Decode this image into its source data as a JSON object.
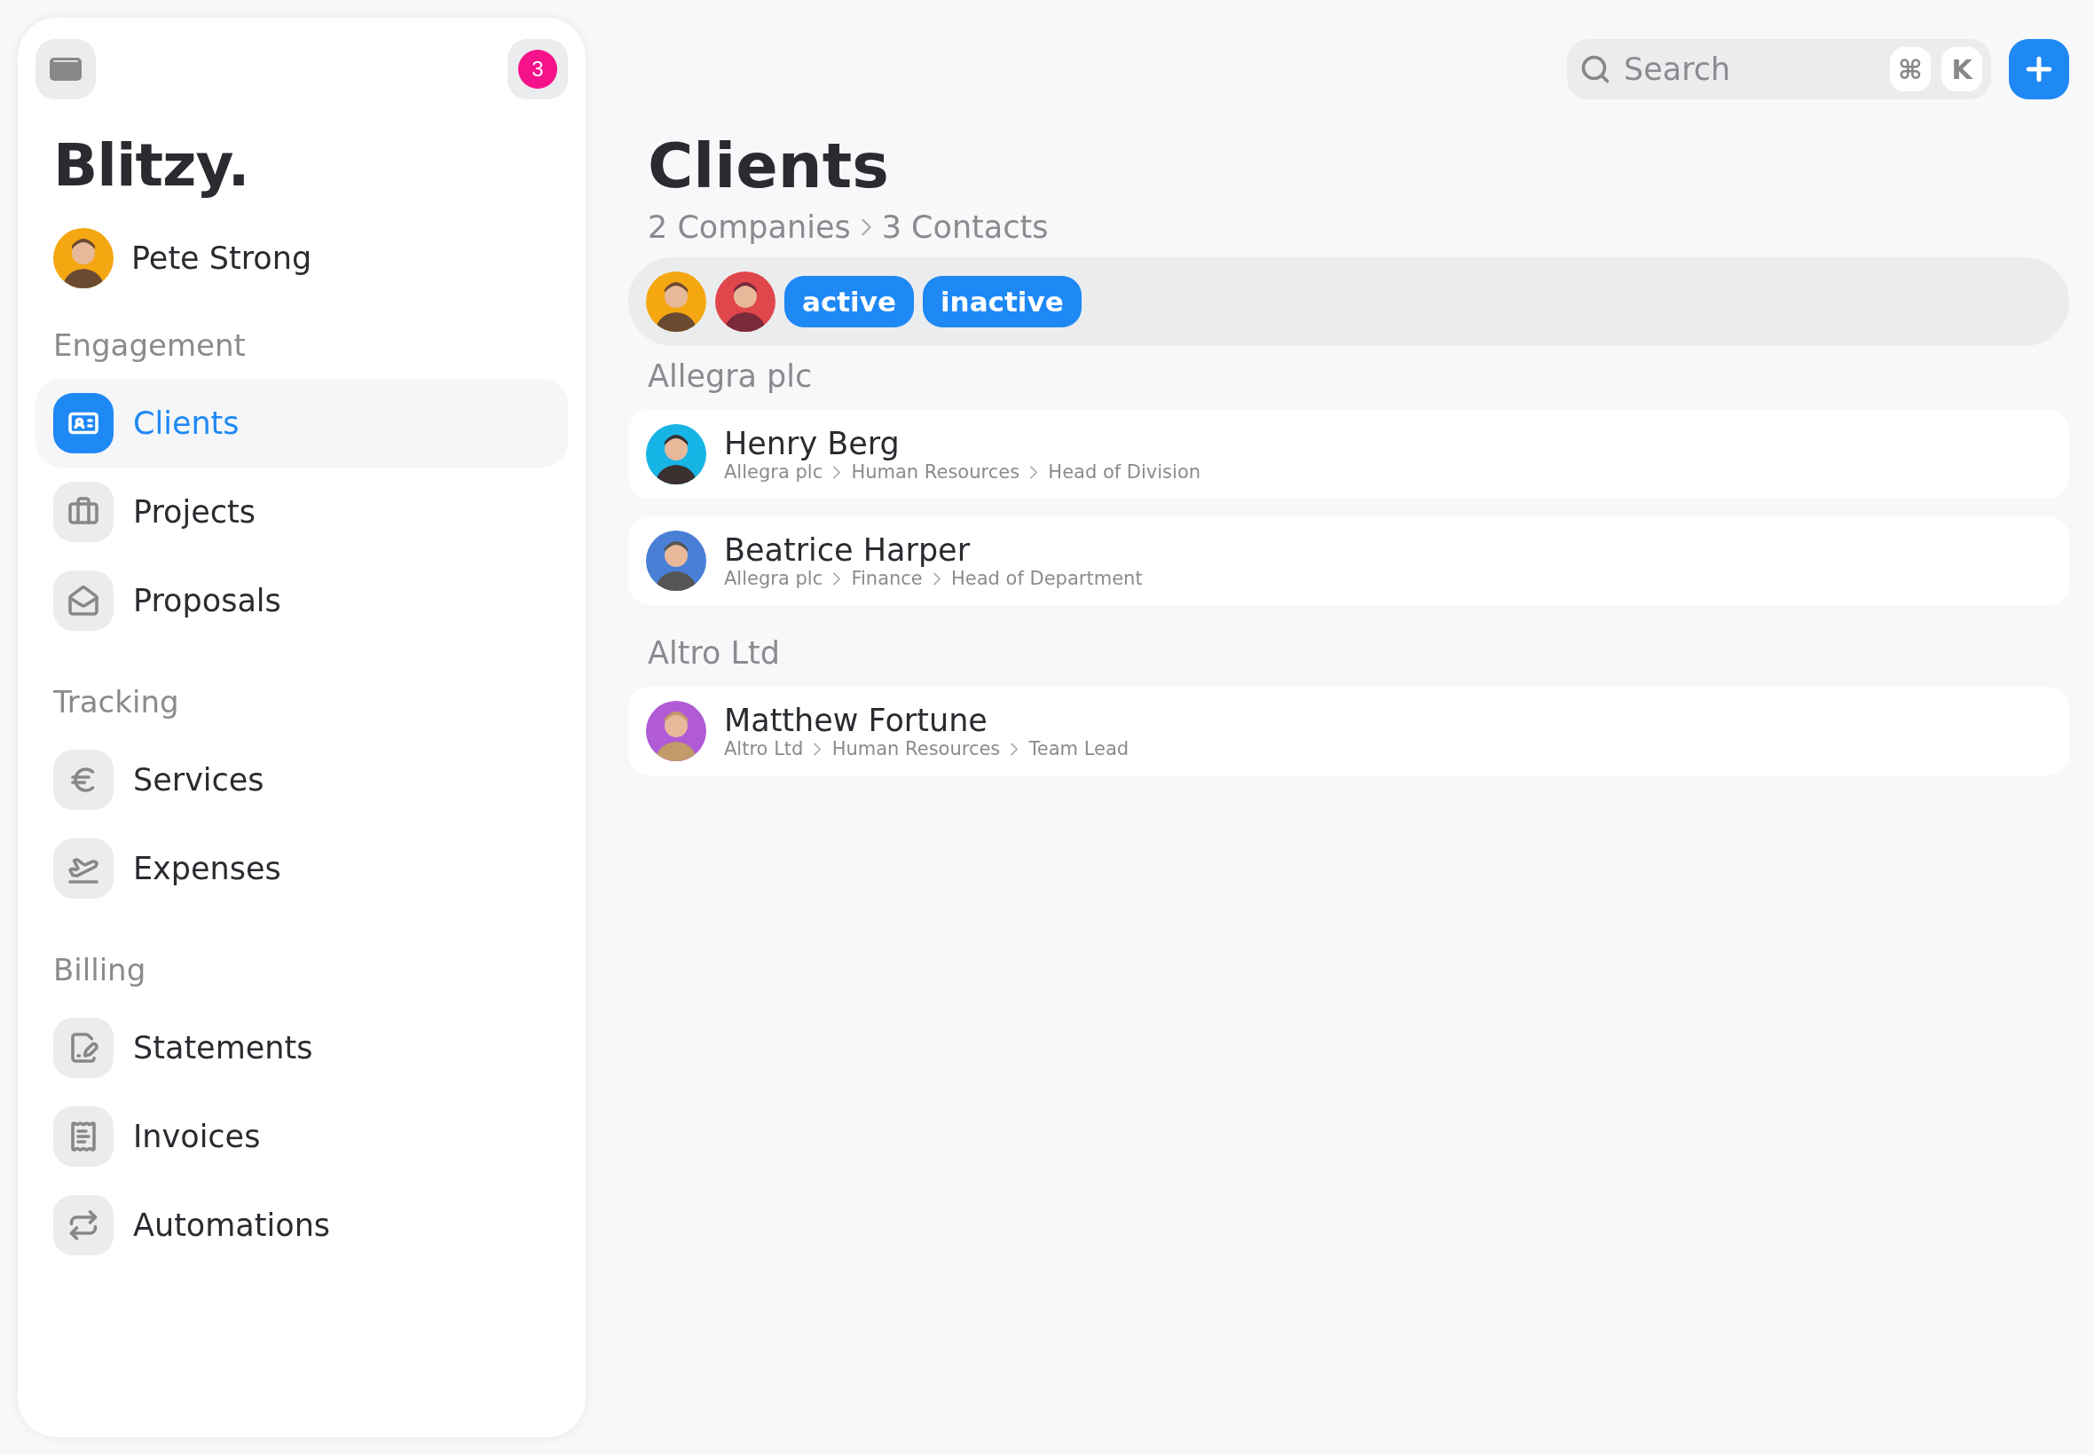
{
  "sidebar": {
    "notifications": "3",
    "brand": "Blitzy.",
    "user": {
      "name": "Pete Strong"
    },
    "sections": [
      {
        "title": "Engagement",
        "items": [
          {
            "label": "Clients",
            "selected": true
          },
          {
            "label": "Projects",
            "selected": false
          },
          {
            "label": "Proposals",
            "selected": false
          }
        ]
      },
      {
        "title": "Tracking",
        "items": [
          {
            "label": "Services",
            "selected": false
          },
          {
            "label": "Expenses",
            "selected": false
          }
        ]
      },
      {
        "title": "Billing",
        "items": [
          {
            "label": "Statements",
            "selected": false
          },
          {
            "label": "Invoices",
            "selected": false
          },
          {
            "label": "Automations",
            "selected": false
          }
        ]
      }
    ]
  },
  "header": {
    "search": {
      "placeholder": "Search",
      "shortcut": [
        "⌘",
        "K"
      ]
    }
  },
  "page": {
    "title": "Clients",
    "breadcrumb": [
      "2 Companies",
      "3 Contacts"
    ],
    "filters": {
      "chips": [
        {
          "label": "active"
        },
        {
          "label": "inactive"
        }
      ]
    },
    "groups": [
      {
        "name": "Allegra plc",
        "contacts": [
          {
            "name": "Henry Berg",
            "path": [
              "Allegra plc",
              "Human Resources",
              "Head of Division"
            ]
          },
          {
            "name": "Beatrice Harper",
            "path": [
              "Allegra plc",
              "Finance",
              "Head of Department"
            ]
          }
        ]
      },
      {
        "name": "Altro Ltd",
        "contacts": [
          {
            "name": "Matthew Fortune",
            "path": [
              "Altro Ltd",
              "Human Resources",
              "Team Lead"
            ]
          }
        ]
      }
    ]
  }
}
